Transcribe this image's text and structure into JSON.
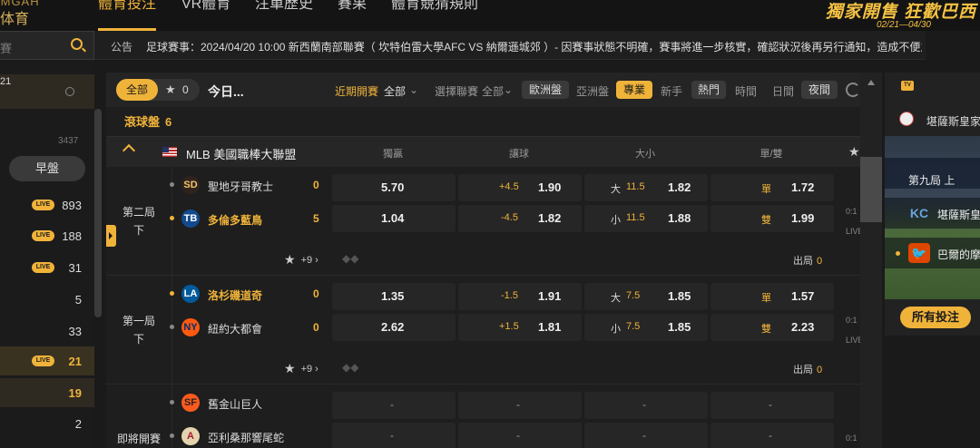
{
  "brand": {
    "top": "IMGAH",
    "name": "体育"
  },
  "nav": {
    "items": [
      "體育投注",
      "VR體育",
      "注單歷史",
      "賽果",
      "體育競猜規則"
    ]
  },
  "promo": {
    "title": "獨家開售 狂歡巴西",
    "dates": "02/21—04/30"
  },
  "search": {
    "placeholder": "賽"
  },
  "announcement": {
    "label": "公告",
    "text": "足球賽事：2024/04/20 10:00 新西蘭南部聯賽（ 坎特伯雷大學AFC VS 納爾遜城郊 ）- 因賽事狀態不明確，賽事將進一步核實，確認狀況後再另行通知，造成不便之處，敬"
  },
  "sidebar": {
    "top_count": "21",
    "partial_count": "3437",
    "early_label": "早盤",
    "items": [
      {
        "live": "LIVE",
        "count": "893"
      },
      {
        "live": "LIVE",
        "count": "188"
      },
      {
        "live": "LIVE",
        "count": "31"
      },
      {
        "live": "",
        "count": "5"
      },
      {
        "live": "",
        "count": "33"
      },
      {
        "live": "LIVE",
        "count": "21"
      },
      {
        "live": "",
        "count": "19"
      },
      {
        "live": "",
        "count": "2"
      }
    ]
  },
  "filters": {
    "all": "全部",
    "fav_count": "0",
    "today": "今日...",
    "recent_label": "近期開賽",
    "recent_value": "全部",
    "league_label": "選擇聯賽",
    "league_value": "全部",
    "odds_eu": "歐洲盤",
    "odds_asia": "亞洲盤",
    "mode_pro": "專業",
    "mode_novice": "新手",
    "sort_hot": "熱門",
    "sort_time": "時間",
    "theme_day": "日間",
    "theme_night": "夜間"
  },
  "inplay": {
    "label": "滾球盤",
    "count": "6"
  },
  "league": {
    "name": "MLB 美國職棒大聯盟",
    "columns": [
      "獨贏",
      "讓球",
      "大小",
      "單/雙"
    ]
  },
  "matches": [
    {
      "period_a": "第二局",
      "period_b": "下",
      "teams": [
        {
          "name": "聖地牙哥教士",
          "score": "0",
          "highlight": false,
          "logo": "SD",
          "logo_bg": "#2f241d",
          "logo_fg": "#f4c36a"
        },
        {
          "name": "多倫多藍鳥",
          "score": "5",
          "highlight": true,
          "logo": "TB",
          "logo_bg": "#134a8e",
          "logo_fg": "#ffffff"
        }
      ],
      "odds": [
        {
          "ml": "5.70",
          "hc": "+4.5",
          "hc_odd": "1.90",
          "ou_lbl": "大",
          "ou": "11.5",
          "ou_odd": "1.82",
          "oe_lbl": "單",
          "oe_odd": "1.72"
        },
        {
          "ml": "1.04",
          "hc": "-4.5",
          "hc_odd": "1.82",
          "ou_lbl": "小",
          "ou": "11.5",
          "ou_odd": "1.88",
          "oe_lbl": "雙",
          "oe_odd": "1.99"
        }
      ],
      "more": "+9",
      "outs_label": "出局",
      "outs": "0"
    },
    {
      "period_a": "第一局",
      "period_b": "下",
      "teams": [
        {
          "name": "洛杉磯道奇",
          "score": "0",
          "highlight": true,
          "logo": "LA",
          "logo_bg": "#005a9c",
          "logo_fg": "#ffffff"
        },
        {
          "name": "紐約大都會",
          "score": "0",
          "highlight": false,
          "logo": "NY",
          "logo_bg": "#ff5910",
          "logo_fg": "#002d72"
        }
      ],
      "odds": [
        {
          "ml": "1.35",
          "hc": "-1.5",
          "hc_odd": "1.91",
          "ou_lbl": "大",
          "ou": "7.5",
          "ou_odd": "1.85",
          "oe_lbl": "單",
          "oe_odd": "1.57"
        },
        {
          "ml": "2.62",
          "hc": "+1.5",
          "hc_odd": "1.81",
          "ou_lbl": "小",
          "ou": "7.5",
          "ou_odd": "1.85",
          "oe_lbl": "雙",
          "oe_odd": "2.23"
        }
      ],
      "more": "+9",
      "outs_label": "出局",
      "outs": "0"
    },
    {
      "period_a": "即將開賽",
      "period_b": "",
      "teams": [
        {
          "name": "舊金山巨人",
          "score": "",
          "highlight": false,
          "logo": "SF",
          "logo_bg": "#fd5a1e",
          "logo_fg": "#27251f"
        },
        {
          "name": "亞利桑那響尾蛇",
          "score": "",
          "highlight": false,
          "logo": "A",
          "logo_bg": "#e3d4ad",
          "logo_fg": "#a71930"
        }
      ],
      "dash": "-"
    }
  ],
  "clipped": [
    "0:1",
    "LIVE",
    "0:1",
    "LIVE",
    "0:1"
  ],
  "right_panel": {
    "tv": "TV",
    "match_title": "堪薩斯皇家",
    "inning": "第九局 上",
    "team1": {
      "name": "堪薩斯皇",
      "logo": "KC"
    },
    "team2": {
      "name": "巴爾的摩",
      "logo": "🐦"
    },
    "all_bets": "所有投注"
  },
  "colors": {
    "accent": "#f0b33a",
    "bg": "#1a1a1a",
    "panel": "#262626"
  }
}
